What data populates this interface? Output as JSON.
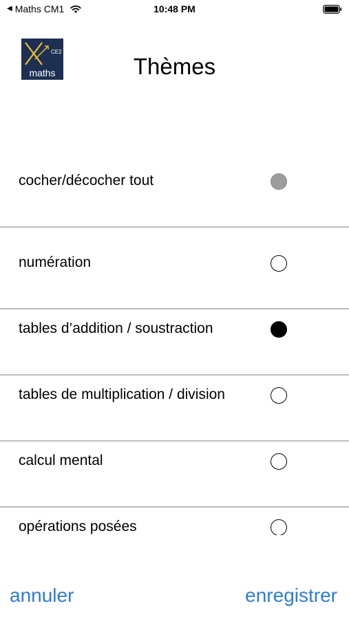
{
  "status_bar": {
    "back_caret": "◀",
    "back_app": "Maths CM1",
    "time": "10:48 PM"
  },
  "header": {
    "logo": {
      "icon": "maths-app-logo",
      "text": "maths",
      "badge": "CE2"
    },
    "title": "Thèmes"
  },
  "list": {
    "items": [
      {
        "label": "cocher/décocher tout",
        "state": "partial"
      },
      {
        "label": "numération",
        "state": "unchecked"
      },
      {
        "label": "tables d’addition / soustraction",
        "state": "checked"
      },
      {
        "label": "tables de multiplication / division",
        "state": "unchecked"
      },
      {
        "label": "calcul mental",
        "state": "unchecked"
      },
      {
        "label": "opérations posées",
        "state": "unchecked"
      }
    ]
  },
  "toolbar": {
    "cancel_label": "annuler",
    "save_label": "enregistrer"
  },
  "colors": {
    "accent": "#2f7bd6",
    "divider": "#bcbcbc",
    "logo_background": "#1d2f52",
    "logo_accent": "#f2c230"
  }
}
